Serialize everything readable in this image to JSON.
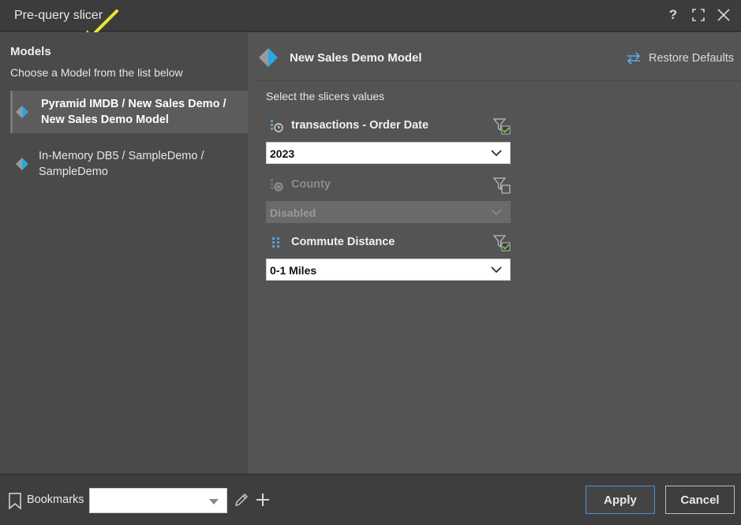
{
  "window": {
    "title": "Pre-query slicer",
    "help_label": "?"
  },
  "models_panel": {
    "heading": "Models",
    "subheading": "Choose a Model from the list below",
    "items": [
      {
        "label": "Pyramid IMDB / New Sales Demo / New Sales Demo Model",
        "selected": true
      },
      {
        "label": "In-Memory DB5 / SampleDemo / SampleDemo",
        "selected": false
      }
    ]
  },
  "model_view": {
    "title": "New Sales Demo Model",
    "restore_label": "Restore Defaults",
    "caption": "Select the slicers values",
    "slicers": [
      {
        "label": "transactions - Order Date",
        "value": "2023",
        "icon": "calendar-clock-icon",
        "enabled": true
      },
      {
        "label": "County",
        "value": "Disabled",
        "icon": "globe-icon",
        "enabled": false
      },
      {
        "label": "Commute Distance",
        "value": "0-1 Miles",
        "icon": "grid-icon",
        "enabled": true
      }
    ]
  },
  "footer": {
    "bookmarks_label": "Bookmarks",
    "bookmark_value": "",
    "apply_label": "Apply",
    "cancel_label": "Cancel"
  },
  "colors": {
    "accent_blue": "#2aa6e0",
    "filter_green": "#6cc04a",
    "annotation_arrow": "#e8e43a",
    "apply_border": "#4a8fd8"
  }
}
